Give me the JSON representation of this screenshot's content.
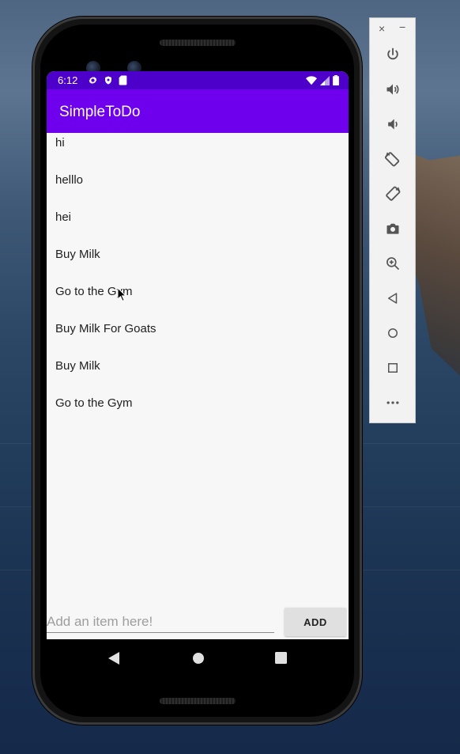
{
  "status_bar": {
    "time": "6:12",
    "left_icons": [
      "gear-icon",
      "shield-icon",
      "sd-card-icon"
    ],
    "right_icons": [
      "wifi-icon",
      "cell-signal-icon",
      "battery-icon"
    ]
  },
  "app_bar": {
    "title": "SimpleToDo",
    "color": "#6f00ee",
    "status_color": "#4d00c9"
  },
  "todo_list": {
    "items": [
      {
        "label": "hi"
      },
      {
        "label": "helllo"
      },
      {
        "label": "hei"
      },
      {
        "label": "Buy Milk"
      },
      {
        "label": "Go to the Gym"
      },
      {
        "label": "Buy Milk For Goats"
      },
      {
        "label": "Buy Milk"
      },
      {
        "label": "Go to the Gym"
      }
    ]
  },
  "input": {
    "placeholder": "Add an item here!",
    "value": ""
  },
  "add_button": {
    "label": "ADD"
  },
  "nav_bar": {
    "buttons": [
      "back-icon",
      "home-icon",
      "recents-icon"
    ]
  },
  "emulator_controls": {
    "window_buttons": {
      "close": "×",
      "minimize": "−"
    },
    "buttons": [
      "power-icon",
      "volume-up-icon",
      "volume-down-icon",
      "rotate-left-icon",
      "rotate-right-icon",
      "camera-icon",
      "zoom-icon",
      "back-icon",
      "home-icon",
      "overview-icon",
      "more-icon"
    ]
  }
}
